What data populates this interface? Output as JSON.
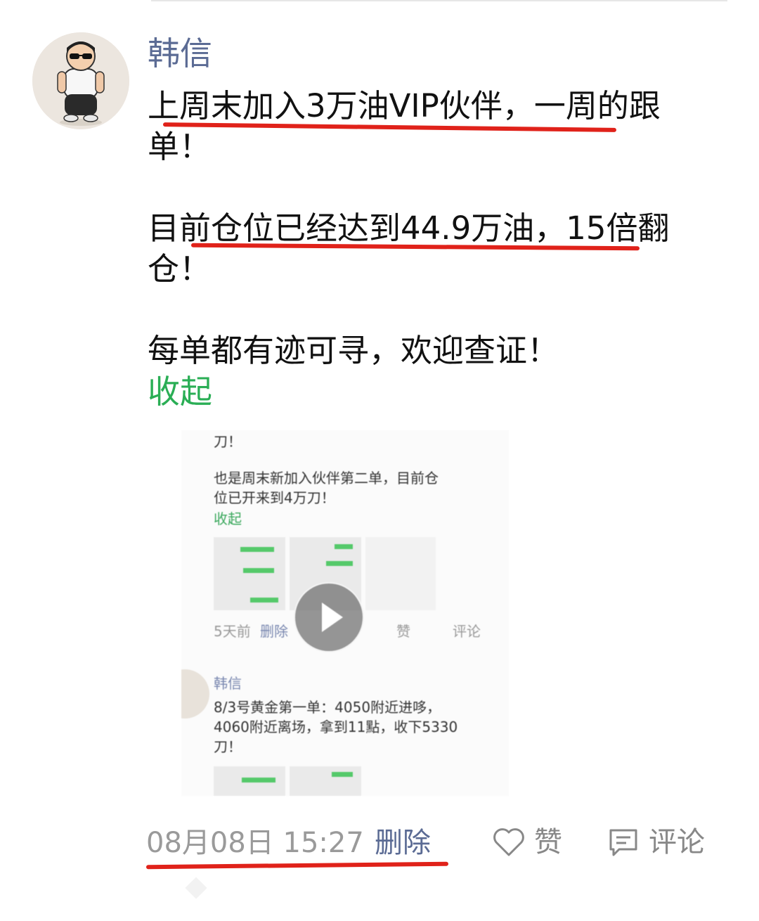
{
  "post": {
    "username": "韩信",
    "paragraphs": [
      "上周末加入3万油VIP伙伴，一周的跟单！",
      "目前仓位已经达到44.9万油，15倍翻仓！",
      "每单都有迹可寻，欢迎查证！"
    ],
    "collapse_label": "收起",
    "timestamp": "08月08日 15:27",
    "delete_label": "删除",
    "like_label": "赞",
    "comment_label": "评论"
  },
  "video_thumbnail": {
    "line_top": "刀！",
    "text_1": "也是周末新加入伙伴第二单，目前仓",
    "text_2": "位已开来到4万刀！",
    "collapse": "收起",
    "time": "5天前",
    "delete": "删除",
    "like": "赞",
    "comment": "评论",
    "username": "韩信",
    "text_3": "8/3号黄金第一单：4050附近进哆，",
    "text_4": "4060附近离场，拿到11點，收下5330",
    "text_5": "刀！"
  },
  "colors": {
    "name_blue": "#5b6b94",
    "link_green": "#2aae55",
    "underline_red": "#e0221a",
    "meta_gray": "#9a9a9a"
  },
  "icons": [
    "heart-icon",
    "comment-icon",
    "play-icon"
  ]
}
